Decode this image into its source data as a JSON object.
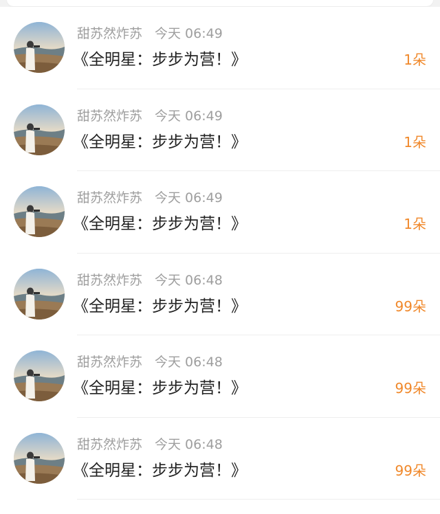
{
  "colors": {
    "accent": "#f0882a",
    "meta_text": "#9e9e9e",
    "title_text": "#222222",
    "background": "#ffffff"
  },
  "rows": [
    {
      "username": "甜苏然炸苏",
      "time": "今天 06:49",
      "title": "《全明星：步步为营！》",
      "count": "1朵"
    },
    {
      "username": "甜苏然炸苏",
      "time": "今天 06:49",
      "title": "《全明星：步步为营！》",
      "count": "1朵"
    },
    {
      "username": "甜苏然炸苏",
      "time": "今天 06:49",
      "title": "《全明星：步步为营！》",
      "count": "1朵"
    },
    {
      "username": "甜苏然炸苏",
      "time": "今天 06:48",
      "title": "《全明星：步步为营！》",
      "count": "99朵"
    },
    {
      "username": "甜苏然炸苏",
      "time": "今天 06:48",
      "title": "《全明星：步步为营！》",
      "count": "99朵"
    },
    {
      "username": "甜苏然炸苏",
      "time": "今天 06:48",
      "title": "《全明星：步步为营！》",
      "count": "99朵"
    }
  ]
}
